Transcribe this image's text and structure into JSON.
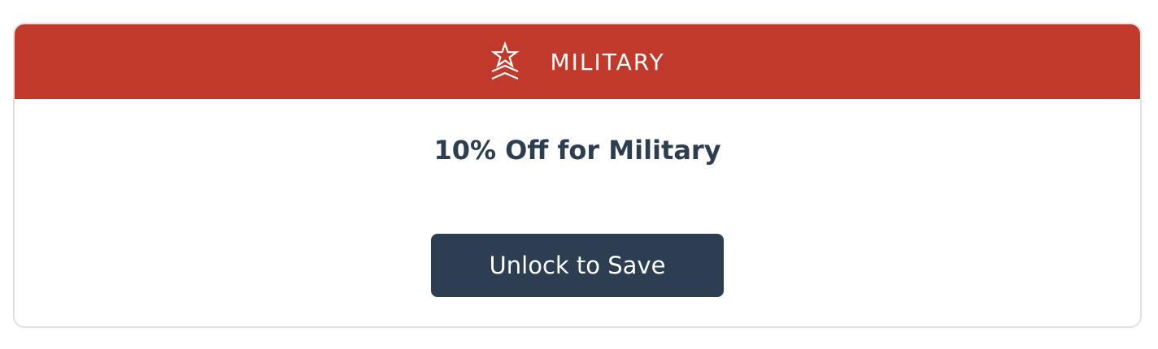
{
  "card": {
    "header": {
      "icon": "military-star-chevron-icon",
      "title": "MILITARY",
      "color": "#c0392b"
    },
    "offer_text": "10% Off for Military",
    "button": {
      "label": "Unlock to Save",
      "color": "#2e3e52"
    }
  }
}
